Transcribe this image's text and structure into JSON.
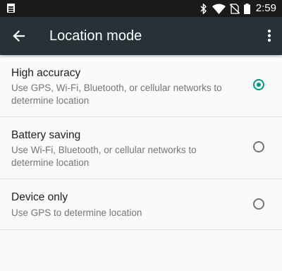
{
  "status_bar": {
    "time": "2:59",
    "icons": [
      "notification-icon",
      "bluetooth-icon",
      "wifi-icon",
      "no-sim-icon",
      "battery-icon"
    ]
  },
  "app_bar": {
    "title": "Location mode",
    "back_icon": "arrow-back-icon",
    "menu_icon": "overflow-menu-icon"
  },
  "options": [
    {
      "title": "High accuracy",
      "summary": "Use GPS, Wi-Fi, Bluetooth, or cellular networks to determine location",
      "selected": true
    },
    {
      "title": "Battery saving",
      "summary": "Use Wi-Fi, Bluetooth, or cellular networks to determine location",
      "selected": false
    },
    {
      "title": "Device only",
      "summary": "Use GPS to determine location",
      "selected": false
    }
  ],
  "colors": {
    "accent": "#009688",
    "app_bar": "#263238",
    "status_bar": "#1a1a1a"
  }
}
